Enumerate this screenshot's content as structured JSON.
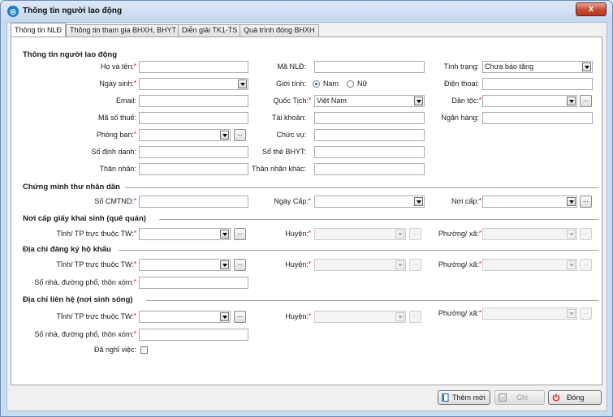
{
  "window": {
    "title": "Thông tin người lao động",
    "close_symbol": "x"
  },
  "tabs": [
    {
      "label": "Thông tin NLĐ",
      "active": true
    },
    {
      "label": "Thông tin tham gia BHXH, BHYT",
      "active": false
    },
    {
      "label": "Diễn giải TK1-TS",
      "active": false
    },
    {
      "label": "Quá trình đóng BHXH",
      "active": false
    }
  ],
  "sections": {
    "worker": "Thông tin người lao động",
    "id_card": "Chứng minh thư nhân dân",
    "birthplace": "Nơi cấp giấy khai sinh (quê quán)",
    "household": "Địa chỉ đăng ký hộ khẩu",
    "contact": "Địa chỉ liên hệ (nơi sinh sống)"
  },
  "fields": {
    "ho_ten": "Họ và tên:",
    "ma_nld": "Mã NLĐ:",
    "tinh_trang": "Tình trạng:",
    "tinh_trang_value": "Chưa báo tăng",
    "ngay_sinh": "Ngày sinh:",
    "gioi_tinh": "Giới tính:",
    "nam": "Nam",
    "nu": "Nữ",
    "dien_thoai": "Điện thoại:",
    "email": "Email:",
    "quoc_tich": "Quốc Tịch:",
    "quoc_tich_value": "Việt Nam",
    "dan_toc": "Dân tộc:",
    "ma_so_thue": "Mã số thuế:",
    "tai_khoan": "Tài khoản:",
    "ngan_hang": "Ngân hàng:",
    "phong_ban": "Phòng ban:",
    "chuc_vu": "Chức vụ:",
    "so_dinh_danh": "Số định danh:",
    "so_the_bhyt": "Số thẻ BHYT:",
    "than_nhan": "Thân nhân:",
    "than_nhan_khac": "Thân nhân khác:",
    "so_cmtnd": "Số CMTND:",
    "ngay_cap": "Ngày Cấp:",
    "noi_cap": "Nơi cấp:",
    "tinh_tp": "Tỉnh/ TP trực thuộc TW:",
    "huyen": "Huyện:",
    "phuong_xa": "Phường/ xã:",
    "so_nha": "Số nhà, đường phố, thôn xóm:",
    "da_nghi_viec": "Đã nghỉ việc:",
    "ellipsis": "..."
  },
  "buttons": {
    "them_moi": "Thêm mới",
    "ghi": "Ghi",
    "dong": "Đóng"
  }
}
